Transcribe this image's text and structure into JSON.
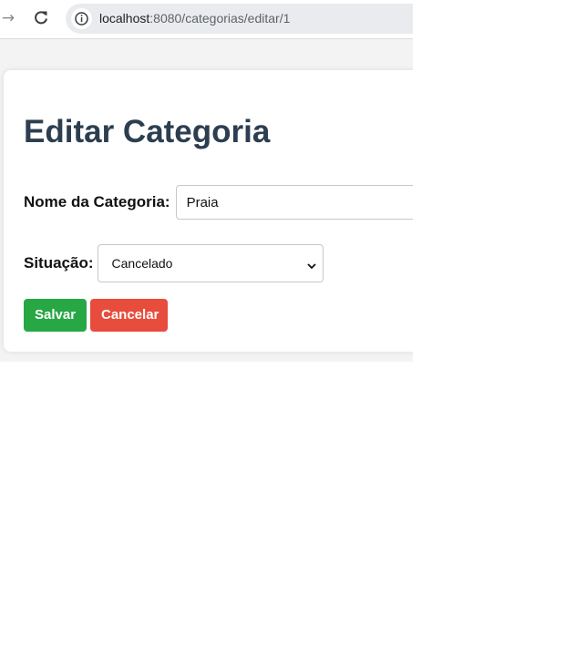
{
  "browser": {
    "url_host": "localhost",
    "url_path": ":8080/categorias/editar/1",
    "forward_icon": "arrow-right-icon",
    "reload_icon": "reload-icon",
    "site_info_icon": "info-icon"
  },
  "page": {
    "title": "Editar Categoria"
  },
  "form": {
    "nome_label": "Nome da Categoria:",
    "nome_value": "Praia",
    "situacao_label": "Situação:",
    "situacao_value": "Cancelado"
  },
  "buttons": {
    "save_label": "Salvar",
    "cancel_label": "Cancelar"
  },
  "colors": {
    "title": "#2c3e50",
    "save": "#28a745",
    "cancel": "#e74c3c",
    "page_background": "#f3f3f3"
  }
}
